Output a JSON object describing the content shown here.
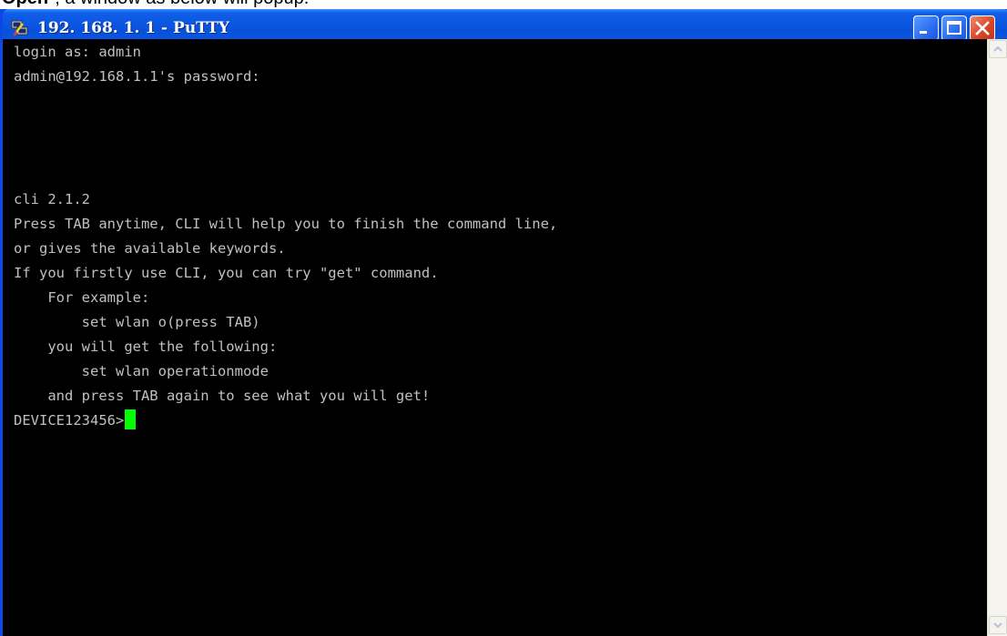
{
  "caption": {
    "bold": "Open",
    "rest": "\", a window as below will popup."
  },
  "window": {
    "title": "192. 168. 1. 1 - PuTTY",
    "icons": {
      "app": "putty-icon",
      "minimize": "minimize-icon",
      "maximize": "maximize-icon",
      "close": "close-icon"
    }
  },
  "terminal": {
    "lines": [
      "login as: admin",
      "admin@192.168.1.1's password:",
      "",
      "",
      "",
      "",
      "cli 2.1.2",
      "Press TAB anytime, CLI will help you to finish the command line,",
      "or gives the available keywords.",
      "If you firstly use CLI, you can try \"get\" command.",
      "    For example:",
      "        set wlan o(press TAB)",
      "    you will get the following:",
      "        set wlan operationmode",
      "    and press TAB again to see what you will get!"
    ],
    "prompt": "DEVICE123456>",
    "colors": {
      "background": "#000000",
      "text": "#c0c0c0",
      "cursor": "#00ff00"
    }
  },
  "scrollbar": {
    "icons": {
      "up": "scroll-up-arrow-icon",
      "down": "scroll-down-arrow-icon"
    }
  }
}
